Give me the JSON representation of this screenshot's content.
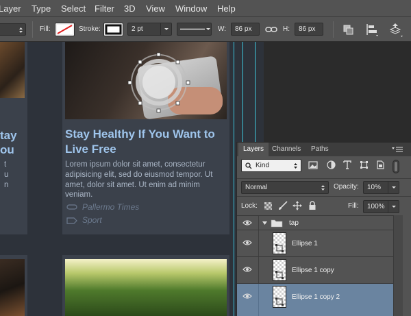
{
  "menubar": {
    "items": [
      "Layer",
      "Type",
      "Select",
      "Filter",
      "3D",
      "View",
      "Window",
      "Help"
    ]
  },
  "options": {
    "fill_label": "Fill:",
    "stroke_label": "Stroke:",
    "stroke_width": "2 pt",
    "w_label": "W:",
    "w_value": "86 px",
    "h_label": "H:",
    "h_value": "86 px"
  },
  "canvas": {
    "card": {
      "title_line1": "Stay Healthy If You Want to",
      "title_line2": "Live Free",
      "body_line1": "Lorem ipsum dolor sit amet, consectetur",
      "body_line2": "adipisicing elit, sed do eiusmod tempor. Ut",
      "body_line3": "amet, dolor sit amet. Ut enim ad minim",
      "body_line4": "veniam.",
      "source": "Pallermo Times",
      "category": "Sport"
    },
    "left_card": {
      "title_line1": "tay",
      "title_line2": "ou",
      "body_line1": "t",
      "body_line2": "u",
      "body_line3": "n"
    }
  },
  "layers_panel": {
    "tabs": [
      "Layers",
      "Channels",
      "Paths"
    ],
    "kind_label": "Kind",
    "blend_mode": "Normal",
    "opacity_label": "Opacity:",
    "opacity_value": "10%",
    "lock_label": "Lock:",
    "fill_label": "Fill:",
    "fill_value": "100%",
    "group_name": "tap",
    "layers": [
      "Ellipse 1",
      "Ellipse 1 copy",
      "Ellipse 1 copy 2"
    ],
    "selected_index": 2
  },
  "colors": {
    "guide": "#3ec7de",
    "title": "#9fc5ec",
    "selected_layer": "#6a84a0"
  }
}
